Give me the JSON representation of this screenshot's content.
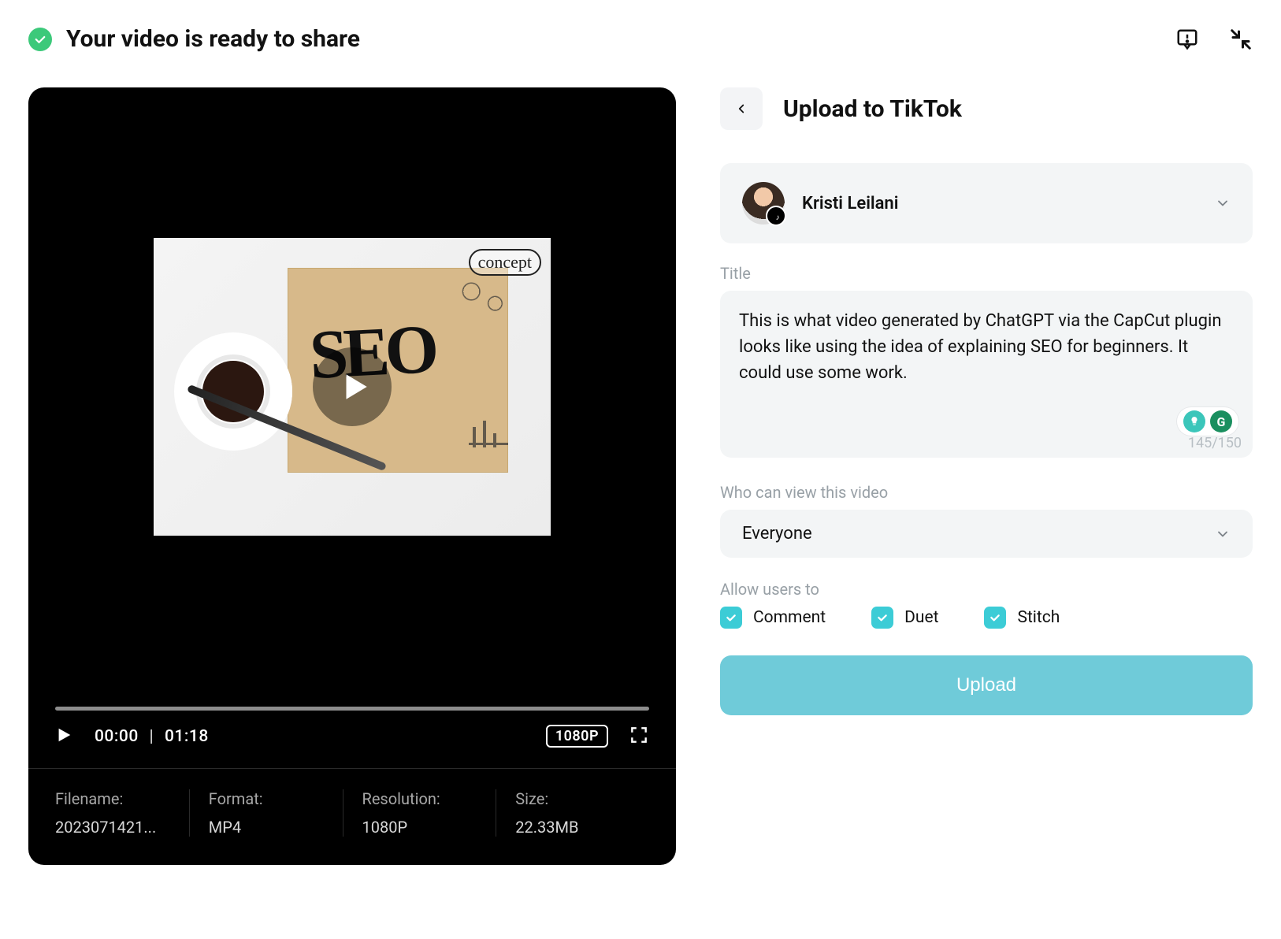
{
  "header": {
    "title": "Your video is ready to share"
  },
  "video": {
    "time_current": "00:00",
    "time_total": "01:18",
    "resolution_badge": "1080P",
    "thumb_concept": "concept",
    "thumb_seo": "SEO"
  },
  "meta": {
    "filename_label": "Filename:",
    "filename_value": "2023071421...",
    "format_label": "Format:",
    "format_value": "MP4",
    "resolution_label": "Resolution:",
    "resolution_value": "1080P",
    "size_label": "Size:",
    "size_value": "22.33MB"
  },
  "upload": {
    "panel_title": "Upload to TikTok",
    "account_name": "Kristi Leilani",
    "title_label": "Title",
    "title_value": "This is what video generated by ChatGPT via the CapCut plugin looks like using the idea of explaining SEO for beginners. It could use some work.",
    "char_count": "145/150",
    "view_label": "Who can view this video",
    "view_selected": "Everyone",
    "allow_label": "Allow users to",
    "checks": {
      "comment": "Comment",
      "duet": "Duet",
      "stitch": "Stitch"
    },
    "button": "Upload",
    "grammarly_letter": "G"
  }
}
